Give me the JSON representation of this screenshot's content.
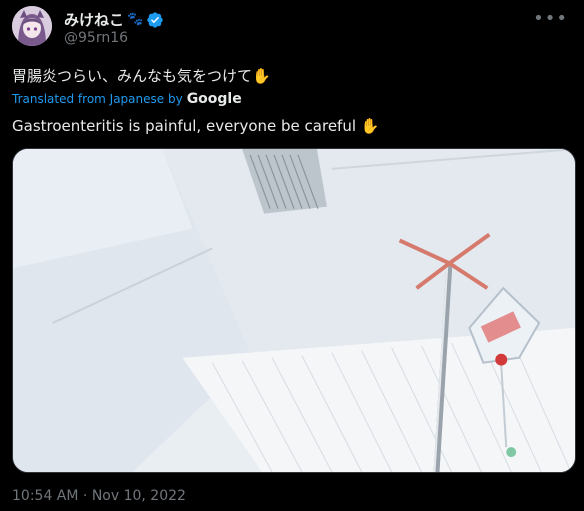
{
  "author": {
    "display_name": "みけねこ",
    "handle": "@95rn16",
    "badge_icon": "paw-print-icon",
    "verified_icon": "verified-badge-icon",
    "verified_color": "#1d9bf0"
  },
  "menu_icon": "more-options-icon",
  "tweet": {
    "original_text": "胃腸炎つらい、みんなも気をつけて",
    "translated_from": "Translated from Japanese by",
    "translator": "Google",
    "translated_text": "Gastroenteritis is painful, everyone be careful",
    "emoji_icon": "raised-hand-emoji"
  },
  "media": {
    "type": "photo",
    "subject_icon": "iv-drip-stand-image"
  },
  "timestamp": {
    "time": "10:54 AM",
    "separator": " · ",
    "date": "Nov 10, 2022"
  },
  "colors": {
    "background": "#000000",
    "text_primary": "#e7e9ea",
    "text_secondary": "#71767b",
    "link": "#1d9bf0"
  }
}
